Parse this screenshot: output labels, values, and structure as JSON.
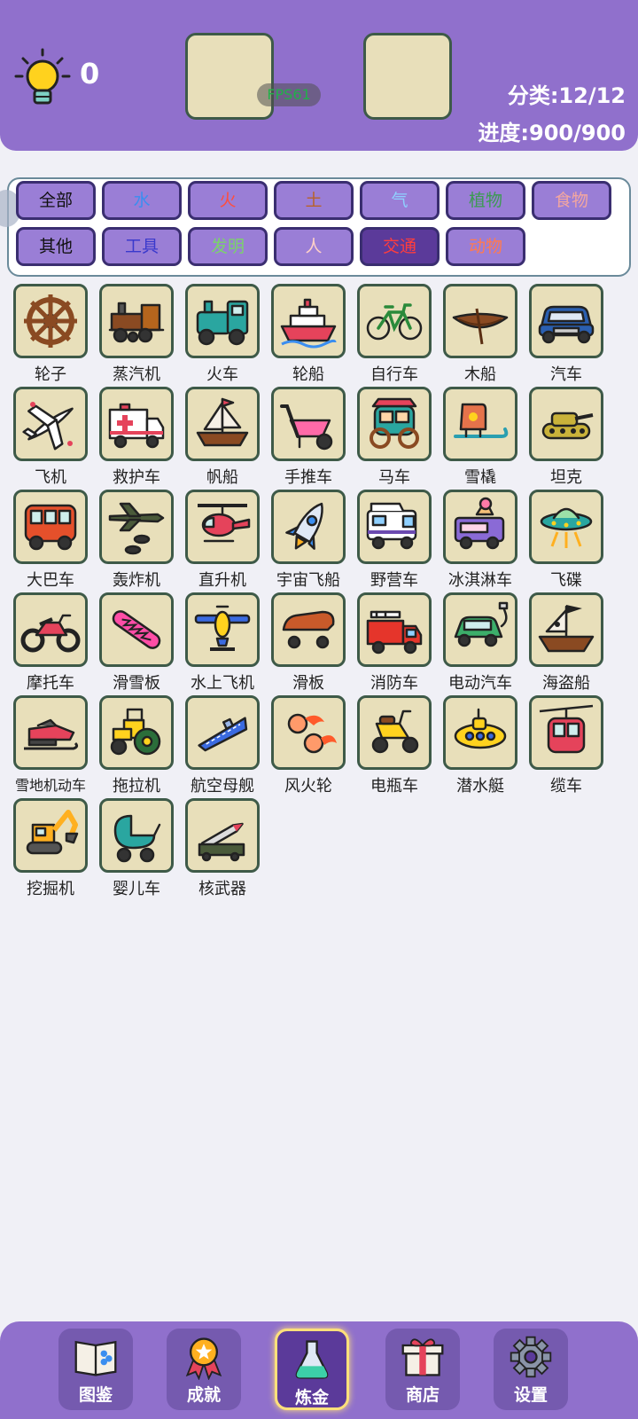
{
  "header": {
    "hint_count": "0",
    "fps": "FPS61",
    "category_stat": "分类:12/12",
    "progress_stat": "进度:900/900"
  },
  "filters": [
    {
      "label": "全部",
      "color": "#111111"
    },
    {
      "label": "水",
      "color": "#3a8ef0"
    },
    {
      "label": "火",
      "color": "#ff4d3d"
    },
    {
      "label": "土",
      "color": "#b8622a"
    },
    {
      "label": "气",
      "color": "#8fd0ff"
    },
    {
      "label": "植物",
      "color": "#3c9a52"
    },
    {
      "label": "食物",
      "color": "#f3a6a0"
    },
    {
      "label": "其他",
      "color": "#111111"
    },
    {
      "label": "工具",
      "color": "#3a39cc"
    },
    {
      "label": "发明",
      "color": "#7bd36a"
    },
    {
      "label": "人",
      "color": "#ffd0c8"
    },
    {
      "label": "交通",
      "color": "#ff3d3d",
      "selected": true
    },
    {
      "label": "动物",
      "color": "#ff7a50"
    }
  ],
  "items": [
    {
      "name": "轮子",
      "icon": "wheel-icon"
    },
    {
      "name": "蒸汽机",
      "icon": "steam-engine-icon"
    },
    {
      "name": "火车",
      "icon": "train-icon"
    },
    {
      "name": "轮船",
      "icon": "ship-icon"
    },
    {
      "name": "自行车",
      "icon": "bicycle-icon"
    },
    {
      "name": "木船",
      "icon": "wooden-boat-icon"
    },
    {
      "name": "汽车",
      "icon": "car-icon"
    },
    {
      "name": "飞机",
      "icon": "airplane-icon"
    },
    {
      "name": "救护车",
      "icon": "ambulance-icon"
    },
    {
      "name": "帆船",
      "icon": "sailboat-icon"
    },
    {
      "name": "手推车",
      "icon": "wheelbarrow-icon"
    },
    {
      "name": "马车",
      "icon": "carriage-icon"
    },
    {
      "name": "雪橇",
      "icon": "sled-icon"
    },
    {
      "name": "坦克",
      "icon": "tank-icon"
    },
    {
      "name": "大巴车",
      "icon": "bus-icon"
    },
    {
      "name": "轰炸机",
      "icon": "bomber-icon"
    },
    {
      "name": "直升机",
      "icon": "helicopter-icon"
    },
    {
      "name": "宇宙飞船",
      "icon": "rocket-icon"
    },
    {
      "name": "野营车",
      "icon": "camper-icon"
    },
    {
      "name": "冰淇淋车",
      "icon": "ice-cream-truck-icon"
    },
    {
      "name": "飞碟",
      "icon": "ufo-icon"
    },
    {
      "name": "摩托车",
      "icon": "motorcycle-icon"
    },
    {
      "name": "滑雪板",
      "icon": "snowboard-icon"
    },
    {
      "name": "水上飞机",
      "icon": "seaplane-icon"
    },
    {
      "name": "滑板",
      "icon": "skateboard-icon"
    },
    {
      "name": "消防车",
      "icon": "fire-truck-icon"
    },
    {
      "name": "电动汽车",
      "icon": "electric-car-icon"
    },
    {
      "name": "海盗船",
      "icon": "pirate-ship-icon"
    },
    {
      "name": "雪地机动车",
      "icon": "snowmobile-icon"
    },
    {
      "name": "拖拉机",
      "icon": "tractor-icon"
    },
    {
      "name": "航空母舰",
      "icon": "aircraft-carrier-icon"
    },
    {
      "name": "风火轮",
      "icon": "fire-wheels-icon"
    },
    {
      "name": "电瓶车",
      "icon": "scooter-icon"
    },
    {
      "name": "潜水艇",
      "icon": "submarine-icon"
    },
    {
      "name": "缆车",
      "icon": "cable-car-icon"
    },
    {
      "name": "挖掘机",
      "icon": "excavator-icon"
    },
    {
      "name": "婴儿车",
      "icon": "stroller-icon"
    },
    {
      "name": "核武器",
      "icon": "nuclear-missile-icon"
    }
  ],
  "nav": [
    {
      "label": "图鉴",
      "icon": "book-icon"
    },
    {
      "label": "成就",
      "icon": "medal-icon"
    },
    {
      "label": "炼金",
      "icon": "flask-icon",
      "active": true
    },
    {
      "label": "商店",
      "icon": "gift-icon"
    },
    {
      "label": "设置",
      "icon": "gear-icon"
    }
  ]
}
